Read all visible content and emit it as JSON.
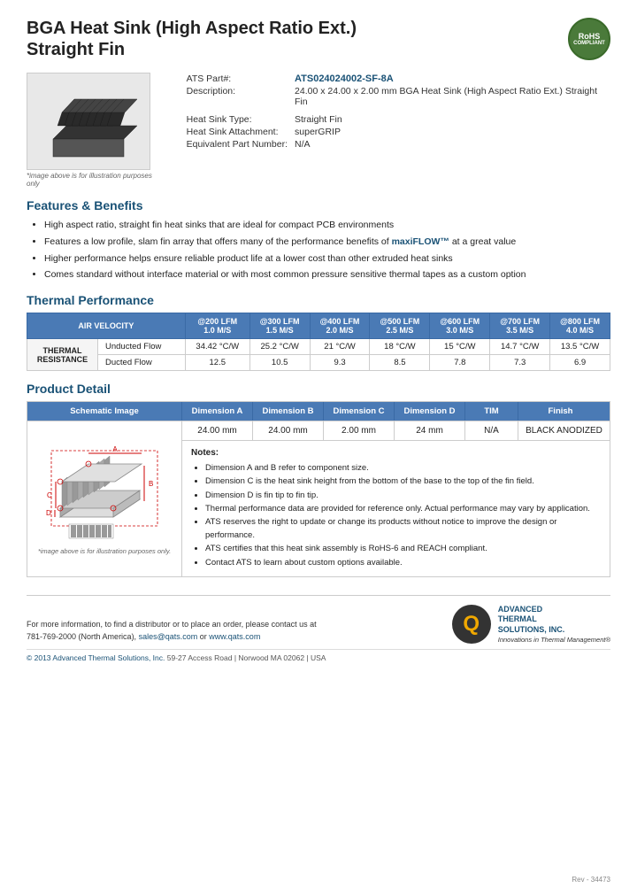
{
  "header": {
    "title_line1": "BGA Heat Sink (High Aspect Ratio Ext.)",
    "title_line2": "Straight Fin"
  },
  "rohs": {
    "line1": "RoHS",
    "line2": "COMPLIANT"
  },
  "product_info": {
    "part_label": "ATS Part#:",
    "part_number": "ATS024024002-SF-8A",
    "description_label": "Description:",
    "description": "24.00 x 24.00 x 2.00 mm  BGA Heat Sink (High Aspect Ratio Ext.) Straight Fin",
    "heat_sink_type_label": "Heat Sink Type:",
    "heat_sink_type": "Straight Fin",
    "attachment_label": "Heat Sink Attachment:",
    "attachment": "superGRIP",
    "equiv_part_label": "Equivalent Part Number:",
    "equiv_part": "N/A",
    "image_note": "*image above is for illustration purposes only"
  },
  "features": {
    "section_title": "Features & Benefits",
    "items": [
      "High aspect ratio, straight fin heat sinks that are ideal for compact PCB environments",
      "Features a low profile, slam fin array that offers many of the performance benefits of maxiFLOW™ at a great value",
      "Higher performance helps ensure reliable product life at a lower cost than other extruded heat sinks",
      "Comes standard without interface material or with most common pressure sensitive thermal tapes as a custom option"
    ]
  },
  "thermal_performance": {
    "section_title": "Thermal Performance",
    "table": {
      "col_air_velocity": "AIR VELOCITY",
      "columns": [
        {
          "header_line1": "@200 LFM",
          "header_line2": "1.0 M/S"
        },
        {
          "header_line1": "@300 LFM",
          "header_line2": "1.5 M/S"
        },
        {
          "header_line1": "@400 LFM",
          "header_line2": "2.0 M/S"
        },
        {
          "header_line1": "@500 LFM",
          "header_line2": "2.5 M/S"
        },
        {
          "header_line1": "@600 LFM",
          "header_line2": "3.0 M/S"
        },
        {
          "header_line1": "@700 LFM",
          "header_line2": "3.5 M/S"
        },
        {
          "header_line1": "@800 LFM",
          "header_line2": "4.0 M/S"
        }
      ],
      "row_label": "THERMAL RESISTANCE",
      "rows": [
        {
          "label": "Unducted Flow",
          "values": [
            "34.42 °C/W",
            "25.2 °C/W",
            "21 °C/W",
            "18 °C/W",
            "15 °C/W",
            "14.7 °C/W",
            "13.5 °C/W"
          ]
        },
        {
          "label": "Ducted Flow",
          "values": [
            "12.5",
            "10.5",
            "9.3",
            "8.5",
            "7.8",
            "7.3",
            "6.9"
          ]
        }
      ]
    }
  },
  "product_detail": {
    "section_title": "Product Detail",
    "headers": {
      "schematic": "Schematic Image",
      "dim_a": "Dimension A",
      "dim_b": "Dimension B",
      "dim_c": "Dimension C",
      "dim_d": "Dimension D",
      "tim": "TIM",
      "finish": "Finish"
    },
    "values": {
      "dim_a": "24.00 mm",
      "dim_b": "24.00 mm",
      "dim_c": "2.00 mm",
      "dim_d": "24 mm",
      "tim": "N/A",
      "finish": "BLACK ANODIZED"
    },
    "schematic_note": "*image above is for illustration purposes only.",
    "notes": {
      "title": "Notes:",
      "items": [
        "Dimension A and B refer to component size.",
        "Dimension C is the heat sink height from the bottom of the base to the top of the fin field.",
        "Dimension D is fin tip to fin tip.",
        "Thermal performance data are provided for reference only. Actual performance may vary by application.",
        "ATS reserves the right to update or change its products without notice to improve the design or performance.",
        "ATS certifies that this heat sink assembly is RoHS-6 and REACH compliant.",
        "Contact ATS to learn about custom options available."
      ]
    }
  },
  "footer": {
    "contact_text": "For more information, to find a distributor or to place an order, please contact us at",
    "phone": "781-769-2000 (North America),",
    "email": "sales@qats.com",
    "email_connector": "or",
    "website": "www.qats.com",
    "company_name_line1": "ADVANCED",
    "company_name_line2": "THERMAL",
    "company_name_line3": "SOLUTIONS, INC.",
    "tagline": "Innovations in Thermal Management®",
    "copyright": "© 2013 Advanced Thermal Solutions, Inc.",
    "address": "59-27 Access Road  |  Norwood MA   02062  |  USA",
    "page_number": "Rev - 34473"
  }
}
